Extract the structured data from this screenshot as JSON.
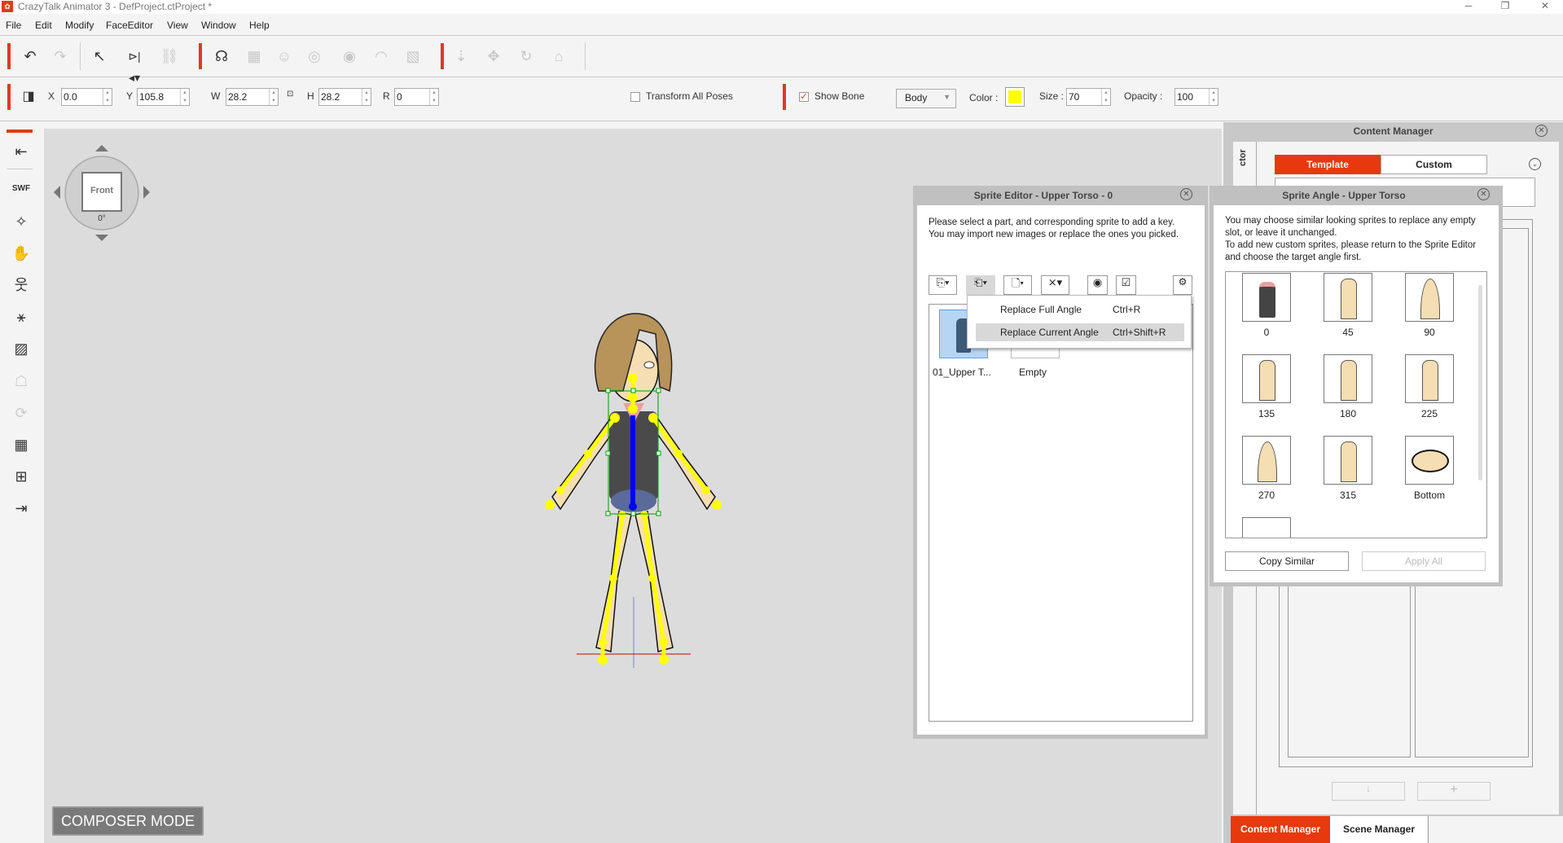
{
  "app": {
    "title": "CrazyTalk Animator 3   - DefProject.ctProject *",
    "icon": "crazytalk-logo-icon"
  },
  "window_controls": {
    "minimize": "─",
    "restore": "❐",
    "close": "✕"
  },
  "menu": [
    "File",
    "Edit",
    "Modify",
    "FaceEditor",
    "View",
    "Window",
    "Help"
  ],
  "colors": {
    "accent": "#e03a1a",
    "bone": "#ffff00",
    "spine": "#0000ff",
    "selection": "#009900"
  },
  "transform": {
    "x_label": "X",
    "x": "0.0",
    "y_label": "Y",
    "y": "105.8",
    "w_label": "W",
    "w": "28.2",
    "h_label": "H",
    "h": "28.2",
    "r_label": "R",
    "r": "0",
    "transform_all_poses": "Transform All Poses",
    "transform_all_checked": false
  },
  "bone": {
    "show_bone": "Show Bone",
    "show_bone_checked": true,
    "mode": "Body",
    "color_label": "Color :",
    "color": "#ffff00",
    "size_label": "Size :",
    "size": "70",
    "opacity_label": "Opacity :",
    "opacity": "100"
  },
  "compass": {
    "view": "Front",
    "angle": "0°"
  },
  "composer_mode": "COMPOSER MODE",
  "sprite_editor": {
    "title": "Sprite Editor - Upper Torso - 0",
    "instructions": [
      "Please select a part, and corresponding sprite to add a key.",
      "You may import new images or replace the ones you picked."
    ],
    "menu": [
      {
        "label": "Replace Full Angle",
        "shortcut": "Ctrl+R"
      },
      {
        "label": "Replace Current Angle",
        "shortcut": "Ctrl+Shift+R",
        "highlighted": true
      }
    ],
    "sprites": [
      {
        "label": "01_Upper T...",
        "selected": true
      },
      {
        "label": "Empty"
      }
    ]
  },
  "sprite_angle": {
    "title": "Sprite Angle - Upper Torso",
    "instructions": [
      "You may choose similar looking sprites to replace any empty slot, or leave it unchanged.",
      "To add new custom sprites, please return to the Sprite Editor and choose the target angle first."
    ],
    "angles": [
      "0",
      "45",
      "90",
      "135",
      "180",
      "225",
      "270",
      "315",
      "Bottom"
    ],
    "copy_similar": "Copy Similar",
    "apply_all": "Apply All"
  },
  "content_manager": {
    "title": "Content Manager",
    "side_label": "ctor",
    "tabs": [
      "Template",
      "Custom"
    ],
    "active_tab": "Template"
  },
  "bottom_tabs": [
    "Content Manager",
    "Scene Manager"
  ]
}
